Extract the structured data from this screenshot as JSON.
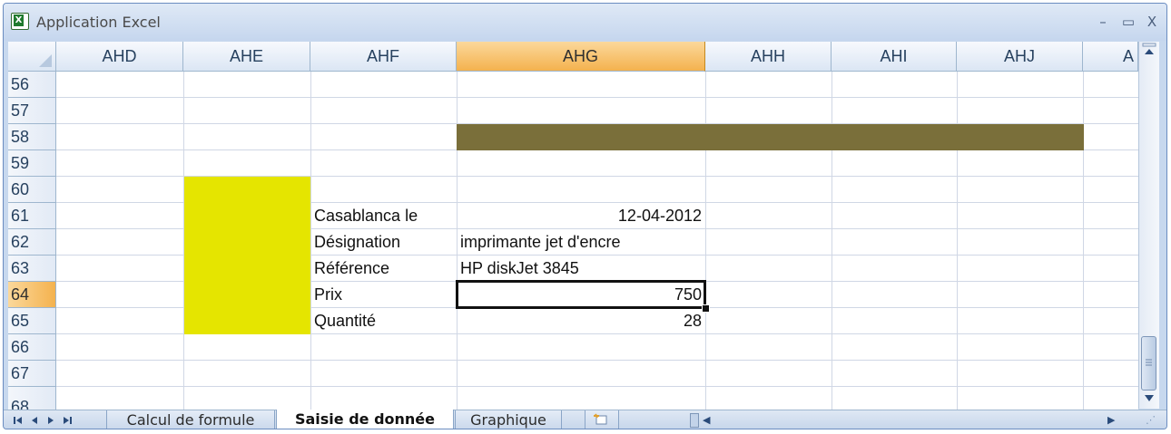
{
  "window": {
    "title": "Application Excel",
    "minimize_glyph": "–",
    "maximize_glyph": "▭",
    "close_glyph": "X"
  },
  "columns": [
    "AHD",
    "AHE",
    "AHF",
    "AHG",
    "AHH",
    "AHI",
    "AHJ",
    "A"
  ],
  "selected_column": "AHG",
  "rows": [
    "56",
    "57",
    "58",
    "59",
    "60",
    "61",
    "62",
    "63",
    "64",
    "65",
    "66",
    "67",
    "68"
  ],
  "selected_row": "64",
  "cells": {
    "r61_label": "Casablanca le",
    "r61_value": "12-04-2012",
    "r62_label": "Désignation",
    "r62_value": "imprimante jet d'encre",
    "r63_label": "Référence",
    "r63_value": "HP diskJet 3845",
    "r64_label": "Prix",
    "r64_value": "750",
    "r65_label": "Quantité",
    "r65_value": "28"
  },
  "fills": {
    "yellow_block_color": "#e5e500",
    "olive_bar_color": "#7a6f3a"
  },
  "sheet_tabs": {
    "tab1": "Calcul de formule",
    "tab2": "Saisie de donnée",
    "tab3": "Graphique",
    "active": "Saisie de donnée"
  },
  "icons": {
    "nav_first": "first-sheet-icon",
    "nav_prev": "prev-sheet-icon",
    "nav_next": "next-sheet-icon",
    "nav_last": "last-sheet-icon",
    "new_sheet": "insert-sheet-icon"
  }
}
